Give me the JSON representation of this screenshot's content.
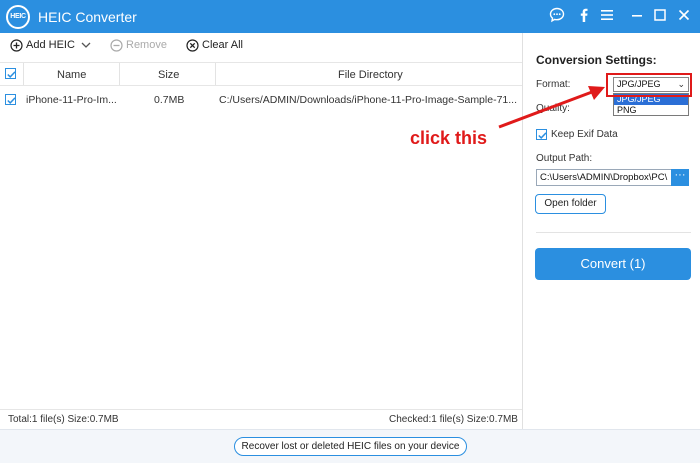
{
  "window": {
    "logo_text": "HEIC",
    "title": "HEIC Converter",
    "icons": [
      "chat-icon",
      "facebook-icon",
      "menu-icon",
      "minimize-icon",
      "maximize-icon",
      "close-icon"
    ],
    "accent_color": "#2b8fe0"
  },
  "toolbar": {
    "add_label": "Add HEIC",
    "remove_label": "Remove",
    "clear_label": "Clear All"
  },
  "table": {
    "columns": [
      "Name",
      "Size",
      "File Directory"
    ],
    "rows": [
      {
        "checked": true,
        "name": "iPhone-11-Pro-Im...",
        "size": "0.7MB",
        "directory": "C:/Users/ADMIN/Downloads/iPhone-11-Pro-Image-Sample-71..."
      }
    ]
  },
  "status": {
    "total": "Total:1 file(s) Size:0.7MB",
    "checked": "Checked:1 file(s) Size:0.7MB"
  },
  "settings": {
    "title": "Conversion Settings:",
    "format_label": "Format:",
    "format_value": "JPG/JPEG",
    "format_options": [
      "JPG/JPEG",
      "PNG"
    ],
    "quality_label": "Quality:",
    "keep_exif_label": "Keep Exif Data",
    "keep_exif_checked": true,
    "output_path_label": "Output Path:",
    "output_path_value": "C:\\Users\\ADMIN\\Dropbox\\PC\\",
    "browse_label": "···",
    "open_folder_label": "Open folder",
    "convert_label": "Convert (1)"
  },
  "footer": {
    "recover_label": "Recover lost or deleted HEIC files on your device"
  },
  "annotation": {
    "text": "click this",
    "color": "#e01a1a"
  }
}
